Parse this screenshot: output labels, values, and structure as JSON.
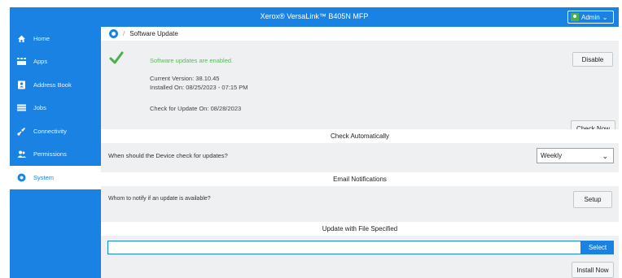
{
  "header": {
    "title": "Xerox® VersaLink™ B405N MFP",
    "admin_label": "Admin"
  },
  "sidebar": {
    "items": [
      {
        "label": "Home",
        "icon": "home-icon"
      },
      {
        "label": "Apps",
        "icon": "apps-icon"
      },
      {
        "label": "Address Book",
        "icon": "address-book-icon"
      },
      {
        "label": "Jobs",
        "icon": "jobs-icon"
      },
      {
        "label": "Connectivity",
        "icon": "connectivity-icon"
      },
      {
        "label": "Permissions",
        "icon": "permissions-icon"
      },
      {
        "label": "System",
        "icon": "gear-icon"
      }
    ],
    "active": "System"
  },
  "breadcrumb": {
    "separator": "/",
    "page": "Software Update"
  },
  "status": {
    "enabled_text": "Software updates are enabled.",
    "current_version": "Current Version: 38.10.45",
    "installed_on": "Installed On: 08/25/2023 - 07:15 PM",
    "check_for_update": "Check for Update On: 08/28/2023",
    "disable_label": "Disable",
    "check_now_label": "Check Now"
  },
  "check_auto": {
    "title": "Check Automatically",
    "question": "When should the Device check for updates?",
    "frequency": "Weekly"
  },
  "email": {
    "title": "Email Notifications",
    "question": "Whom to notify if an update is available?",
    "setup_label": "Setup"
  },
  "file_update": {
    "title": "Update with File Specified",
    "file_value": "",
    "select_label": "Select",
    "install_label": "Install Now"
  },
  "colors": {
    "accent": "#1a82e2",
    "success": "#5cb85c",
    "panel": "#eef0f2"
  }
}
